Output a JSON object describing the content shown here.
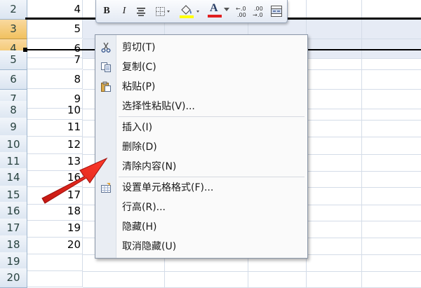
{
  "rows": [
    {
      "num": "2",
      "value": "4"
    },
    {
      "num": "3",
      "value": "5"
    },
    {
      "num": "4",
      "value": "6"
    },
    {
      "num": "5",
      "value": "7"
    },
    {
      "num": "6",
      "value": "8"
    },
    {
      "num": "7",
      "value": "9"
    },
    {
      "num": "8",
      "value": "10"
    },
    {
      "num": "9",
      "value": "11"
    },
    {
      "num": "10",
      "value": "12"
    },
    {
      "num": "11",
      "value": "13"
    },
    {
      "num": "14",
      "value": "16"
    },
    {
      "num": "15",
      "value": "17"
    },
    {
      "num": "16",
      "value": "18"
    },
    {
      "num": "17",
      "value": "19"
    },
    {
      "num": "18",
      "value": "20"
    },
    {
      "num": "19",
      "value": ""
    },
    {
      "num": "20",
      "value": ""
    }
  ],
  "selected_rows": [
    "3",
    "4"
  ],
  "toolbar": {
    "bold_label": "B",
    "italic_label": "I",
    "font_color_label": "A",
    "font_color": "#e02020",
    "fill_color": "#ffff00"
  },
  "context_menu": {
    "cut": "剪切(T)",
    "copy": "复制(C)",
    "paste": "粘贴(P)",
    "paste_special": "选择性粘贴(V)...",
    "insert": "插入(I)",
    "delete": "删除(D)",
    "clear_contents": "清除内容(N)",
    "format_cells": "设置单元格格式(F)...",
    "row_height": "行高(R)...",
    "hide": "隐藏(H)",
    "unhide": "取消隐藏(U)"
  },
  "colors": {
    "arrow": "#e0201b",
    "selection_header": "#f1c15f",
    "selection_fill": "#e6ebf5"
  }
}
